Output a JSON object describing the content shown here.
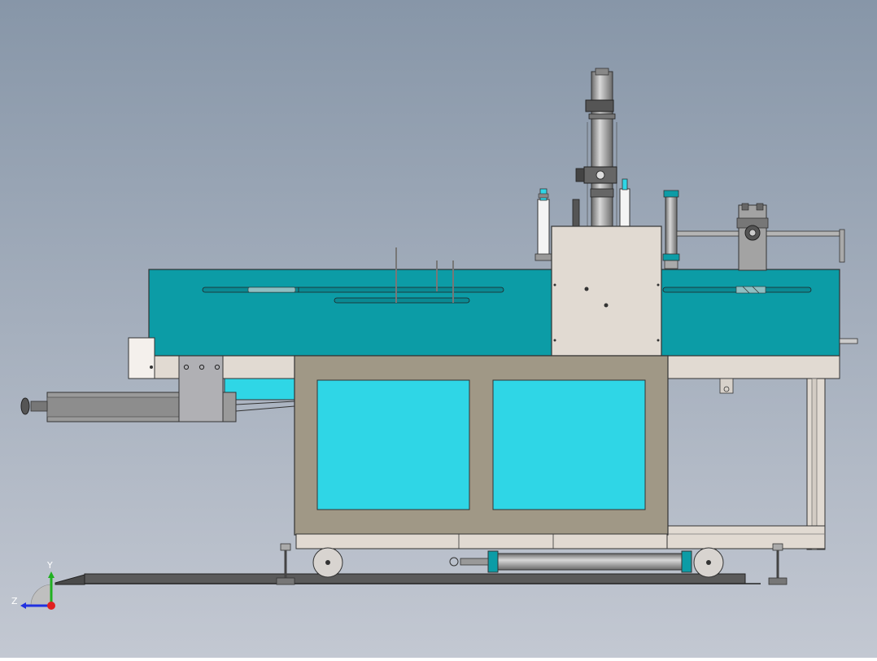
{
  "scene": {
    "background_top": "#8796a8",
    "background_bottom": "#c3c8d2",
    "teal": "#0c9ca6",
    "cyan": "#2fd6e6",
    "frame_gray": "#a09886",
    "light_beige": "#e1dad2",
    "line": "#333333"
  },
  "triad": {
    "y_label": "Y",
    "z_label": "Z",
    "x_color": "#e02020",
    "y_color": "#20b020",
    "z_color": "#2030e0"
  }
}
